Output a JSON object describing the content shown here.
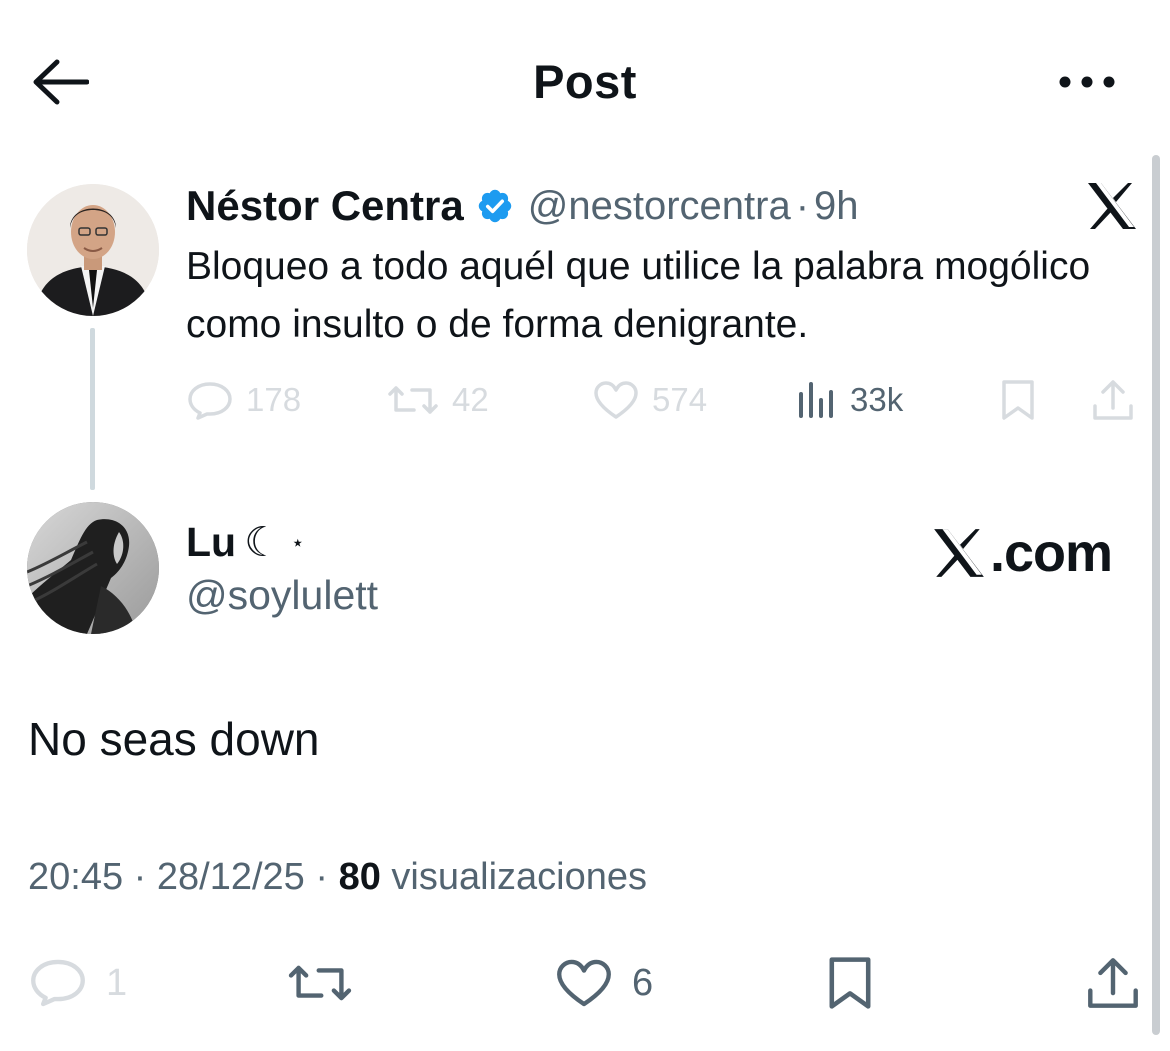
{
  "header": {
    "title": "Post",
    "back_icon": "arrow-left-icon",
    "more_icon": "more-horizontal-icon"
  },
  "parent_tweet": {
    "author_name": "Néstor Centra",
    "handle": "@nestorcentra",
    "separator": "·",
    "time": "9h",
    "text": "Bloqueo a todo aquél que utilice la palabra mogólico como insulto o de forma denigrante.",
    "verified_color": "#1d9bf0",
    "stats": {
      "replies": "178",
      "reposts": "42",
      "likes": "574",
      "views": "33k"
    }
  },
  "reply": {
    "author_name": "Lu",
    "name_moon": "☾",
    "name_star": "⋆",
    "handle": "@soylulett",
    "text": "No seas down",
    "watermark": ".com",
    "meta": {
      "time": "20:45",
      "sep1": "·",
      "date": "28/12/25",
      "sep2": "·",
      "views_count": "80",
      "views_label": "visualizaciones"
    },
    "stats": {
      "replies": "1",
      "likes": "6"
    }
  },
  "colors": {
    "text_primary": "#0f1419",
    "text_secondary": "#536471",
    "faded_icon": "#d7dbdf",
    "thread_line": "#cfd9de"
  }
}
